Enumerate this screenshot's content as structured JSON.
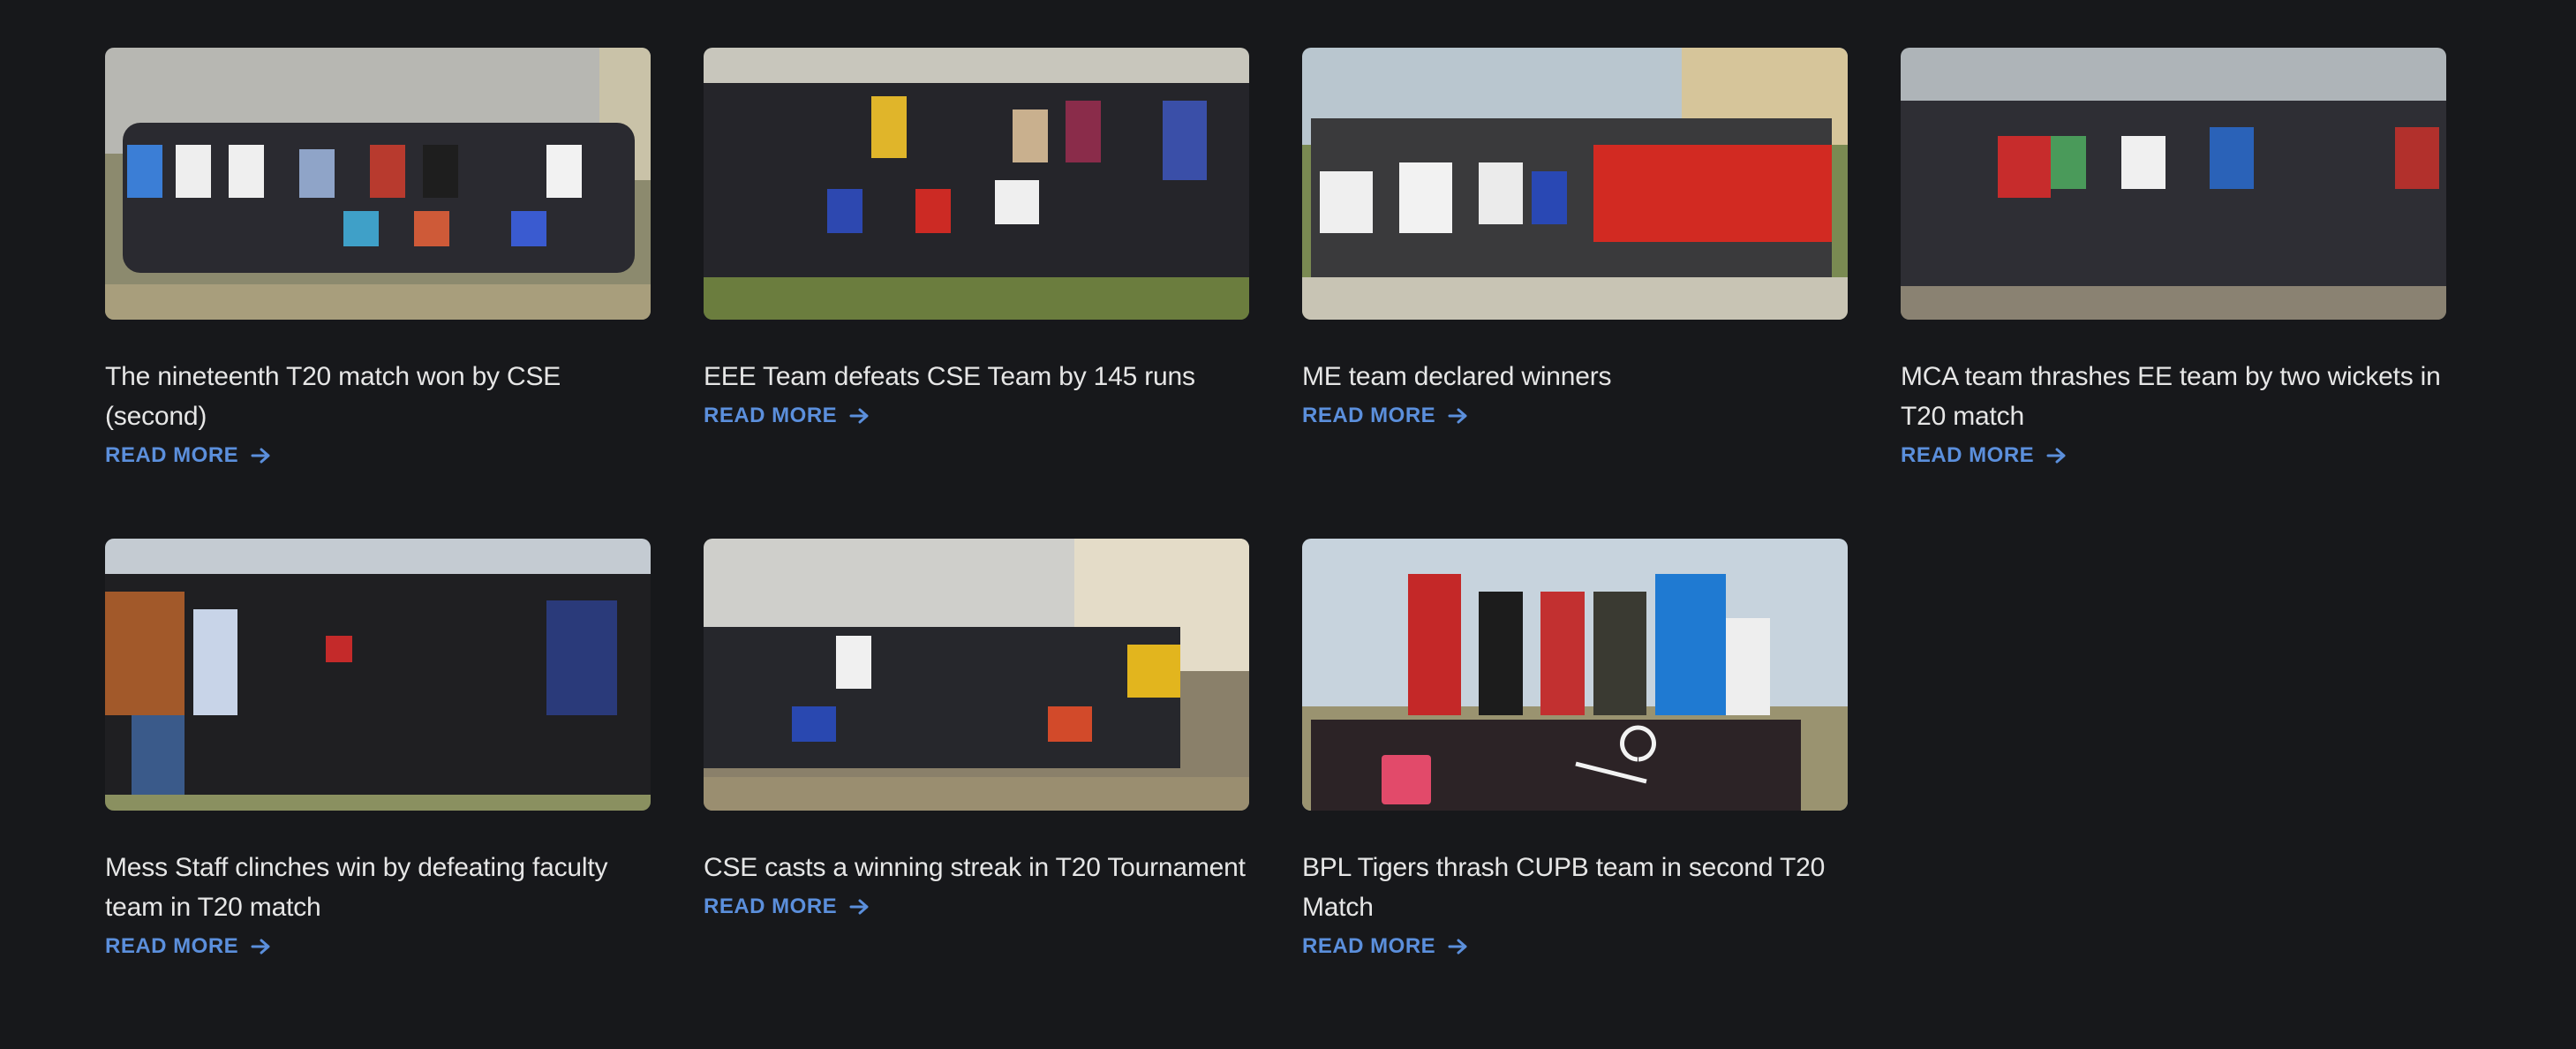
{
  "colors": {
    "background": "#17181b",
    "title_text": "#e6e6e6",
    "link": "#5b8fdc"
  },
  "read_more_icon": "arrow-right-icon",
  "cards": [
    {
      "title": "The nineteenth T20 match won by CSE (second)",
      "link": "READ MORE"
    },
    {
      "title": "EEE Team defeats CSE Team by 145 runs",
      "link": "READ MORE"
    },
    {
      "title": "ME team declared winners",
      "link": "READ MORE"
    },
    {
      "title": "MCA team thrashes EE team by two wickets in T20 match",
      "link": "READ MORE"
    },
    {
      "title": "Mess Staff clinches win by defeating faculty team in T20 match",
      "link": "READ MORE"
    },
    {
      "title": "CSE casts a winning streak in T20 Tournament",
      "link": "READ MORE"
    },
    {
      "title": "BPL Tigers thrash CUPB team in second T20 Match",
      "link": "READ MORE"
    }
  ]
}
